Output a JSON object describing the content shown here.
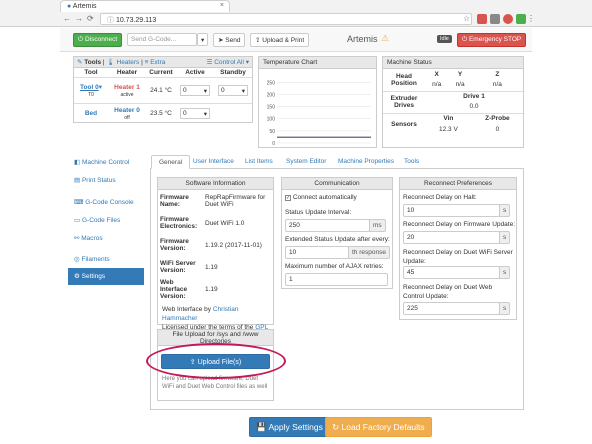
{
  "browser": {
    "tab_title": "Artemis",
    "url": "10.73.29.113"
  },
  "topbar": {
    "disconnect_label": "Disconnect",
    "gcode_placeholder": "Send G-Code...",
    "send_label": "Send",
    "upload_print_label": "Upload & Print",
    "machine_name": "Artemis",
    "status_badge": "Idle",
    "emergency_label": "Emergency STOP"
  },
  "tools_panel": {
    "header_tools": "Tools",
    "header_heaters": "Heaters",
    "header_extra": "Extra",
    "header_control": "Control All",
    "columns": [
      "Tool",
      "Heater",
      "Current",
      "Active",
      "Standby"
    ],
    "rows": [
      {
        "tool": "Tool 0",
        "tool_sub": "T0",
        "heater": "Heater 1",
        "heater_sub": "active",
        "current": "24.1 °C",
        "active": "0",
        "standby": "0"
      },
      {
        "tool": "Bed",
        "tool_sub": "",
        "heater": "Heater 0",
        "heater_sub": "off",
        "current": "23.5 °C",
        "active": "0",
        "standby": ""
      }
    ]
  },
  "temp_chart": {
    "title": "Temperature Chart",
    "chart_data": {
      "type": "line",
      "y_ticks": [
        "250",
        "200",
        "150",
        "100",
        "50",
        "0"
      ],
      "ylim": [
        0,
        280
      ],
      "series": [
        {
          "values": [
            24,
            24
          ],
          "color": "#d9534f"
        },
        {
          "values": [
            23.5,
            23.5
          ],
          "color": "#337ab7"
        }
      ]
    }
  },
  "machine_status": {
    "title": "Machine Status",
    "head_position_label": "Head Position",
    "axes": [
      "X",
      "Y",
      "Z"
    ],
    "positions": [
      "n/a",
      "n/a",
      "n/a"
    ],
    "extruder_label": "Extruder Drives",
    "drive_label": "Drive 1",
    "drive_value": "0.0",
    "sensors_label": "Sensors",
    "vin_label": "Vin",
    "zprobe_label": "Z-Probe",
    "vin_value": "12.3 V",
    "zprobe_value": "0"
  },
  "sidebar": {
    "items": [
      {
        "label": "Machine Control",
        "icon": "dashboard-icon"
      },
      {
        "label": "Print Status",
        "icon": "print-icon"
      },
      {
        "label": "G-Code Console",
        "icon": "console-icon"
      },
      {
        "label": "G-Code Files",
        "icon": "file-icon"
      },
      {
        "label": "Macros",
        "icon": "macros-icon"
      },
      {
        "label": "Filaments",
        "icon": "filament-icon"
      },
      {
        "label": "Settings",
        "icon": "gear-icon"
      }
    ]
  },
  "settings_tabs": [
    "General",
    "User Interface",
    "List Items",
    "System Editor",
    "Machine Properties",
    "Tools"
  ],
  "software_info": {
    "title": "Software Information",
    "rows": [
      {
        "label": "Firmware Name:",
        "value": "RepRapFirmware for Duet WiFi"
      },
      {
        "label": "Firmware Electronics:",
        "value": "Duet WiFi 1.0"
      },
      {
        "label": "Firmware Version:",
        "value": "1.19.2 (2017-11-01)"
      },
      {
        "label": "WiFi Server Version:",
        "value": "1.19"
      },
      {
        "label": "Web Interface Version:",
        "value": "1.19"
      }
    ],
    "credit_prefix": "Web Interface by",
    "credit_author": "Christian Hammacher",
    "license_prefix": "Licensed under the terms of the",
    "license_link": "GPL v3"
  },
  "file_upload": {
    "title": "File Upload for /sys and /www Directories",
    "button_label": "Upload File(s)",
    "help_text": "Here you can upload firmware, Duet WiFi and Duet Web Control files as well"
  },
  "communication": {
    "title": "Communication",
    "connect_auto_label": "Connect automatically",
    "status_interval_label": "Status Update Interval:",
    "status_interval_value": "250",
    "status_interval_unit": "ms",
    "extended_label": "Extended Status Update after every:",
    "extended_value": "10",
    "extended_unit": "th response",
    "ajax_label": "Maximum number of AJAX retries:",
    "ajax_value": "1"
  },
  "reconnect": {
    "title": "Reconnect Preferences",
    "halt_label": "Reconnect Delay on Halt:",
    "halt_value": "10",
    "fw_label": "Reconnect Delay on Firmware Update:",
    "fw_value": "20",
    "wifi_label": "Reconnect Delay on Duet WiFi Server Update:",
    "wifi_value": "45",
    "dwc_label": "Reconnect Delay on Duet Web Control Update:",
    "dwc_value": "225",
    "unit": "s"
  },
  "footer": {
    "apply_label": "Apply Settings",
    "factory_label": "Load Factory Defaults"
  },
  "colors": {
    "accent": "#337ab7",
    "highlight": "#c2185b"
  }
}
